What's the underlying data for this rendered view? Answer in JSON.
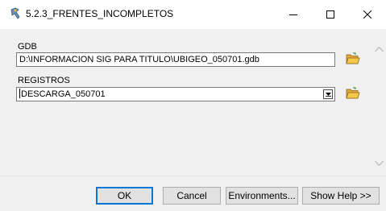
{
  "window": {
    "title": "5.2.3_FRENTES_INCOMPLETOS"
  },
  "form": {
    "gdb_label": "GDB",
    "gdb_value": "D:\\INFORMACION SIG PARA TITULO\\UBIGEO_050701.gdb",
    "registros_label": "REGISTROS",
    "registros_value": "DESCARGA_050701"
  },
  "buttons": {
    "ok": "OK",
    "cancel": "Cancel",
    "environments": "Environments...",
    "show_help": "Show Help >>"
  },
  "icons": {
    "app": "tool-icon",
    "browse": "folder-open-icon",
    "minimize": "minimize-icon",
    "maximize": "maximize-icon",
    "close": "close-icon"
  },
  "colors": {
    "dialog_bg": "#f0f0f0",
    "default_button_border": "#0078d7",
    "folder_yellow": "#f5c84a"
  }
}
